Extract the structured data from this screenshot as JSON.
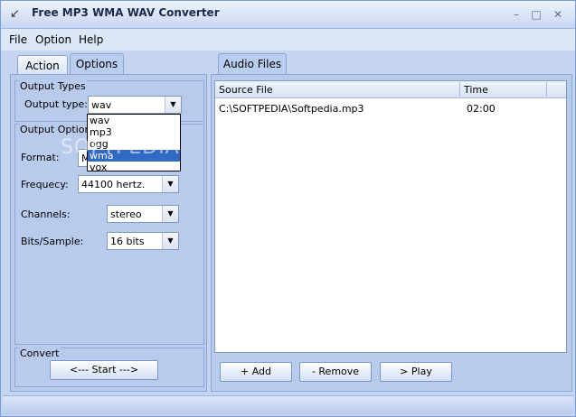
{
  "window": {
    "title": "Free MP3 WMA WAV Converter"
  },
  "menu": [
    {
      "label": "File"
    },
    {
      "label": "Option"
    },
    {
      "label": "Help"
    }
  ],
  "left_tabs": [
    {
      "label": "Action"
    },
    {
      "label": "Options"
    }
  ],
  "output_types": {
    "group_label": "Output Types",
    "type_label": "Output type:",
    "type_value": "wav",
    "options": [
      "wav",
      "mp3",
      "ogg",
      "wma",
      "vox"
    ],
    "highlighted": "wma"
  },
  "output_options": {
    "group_label": "Output Options",
    "format_label": "Format:",
    "format_value": "M",
    "frequency_label": "Frequecy:",
    "frequency_value": "44100 hertz.",
    "channels_label": "Channels:",
    "channels_value": "stereo",
    "bits_label": "Bits/Sample:",
    "bits_value": "16 bits"
  },
  "convert": {
    "group_label": "Convert",
    "start_label": "<--- Start --->"
  },
  "right_tab": {
    "label": "Audio Files"
  },
  "file_list": {
    "columns": [
      "Source File",
      "Time"
    ],
    "rows": [
      {
        "source": "C:\\SOFTPEDIA\\Softpedia.mp3",
        "time": "02:00"
      }
    ]
  },
  "actions": {
    "add": "+ Add",
    "remove": "- Remove",
    "play": "> Play"
  },
  "watermark": "SOFTPEDIA"
}
